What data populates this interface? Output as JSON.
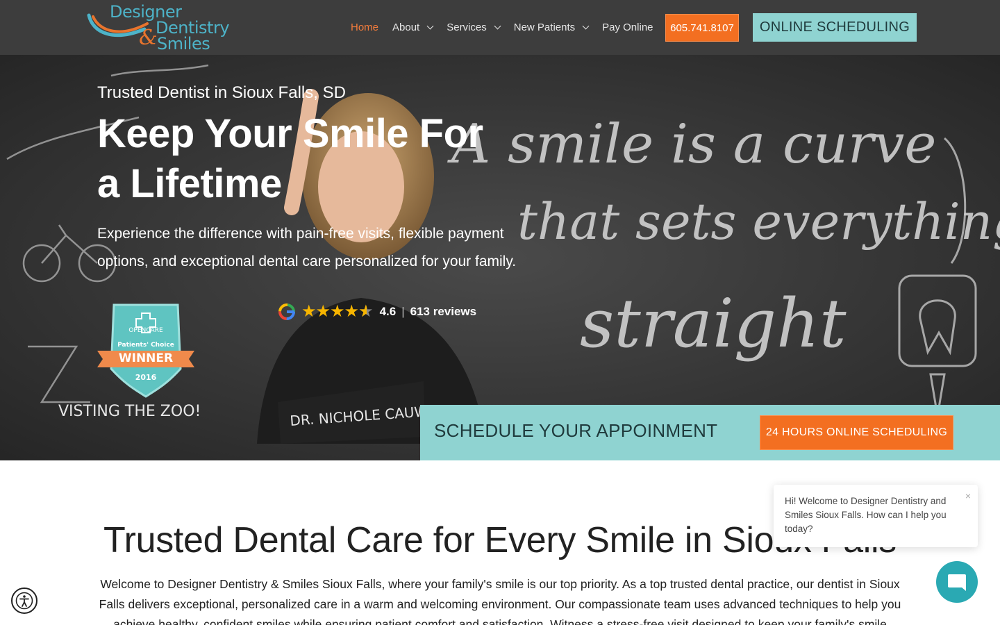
{
  "header": {
    "logo": {
      "line1": "Designer",
      "line2": "Dentistry",
      "amp": "&",
      "line3": "Smiles"
    },
    "nav": [
      {
        "label": "Home",
        "active": true,
        "dropdown": false
      },
      {
        "label": "About",
        "active": false,
        "dropdown": true
      },
      {
        "label": "Services",
        "active": false,
        "dropdown": true
      },
      {
        "label": "New Patients",
        "active": false,
        "dropdown": true
      },
      {
        "label": "Pay Online",
        "active": false,
        "dropdown": false
      }
    ],
    "phone": "605.741.8107",
    "schedule_label": "ONLINE SCHEDULING"
  },
  "hero": {
    "eyebrow": "Trusted Dentist in Sioux Falls, SD",
    "title_line1": "Keep Your Smile For",
    "title_line2": "a Lifetime",
    "subtitle": "Experience the difference with pain-free visits, flexible payment options, and exceptional dental care personalized for your family.",
    "badge": {
      "brand": "OPENCARE",
      "subtitle": "Patients' Choice",
      "title": "WINNER",
      "year": "2016"
    },
    "rating": {
      "score": "4.6",
      "stars": 4.6,
      "reviews": "613 reviews"
    },
    "chalk_words": [
      "A smile is a curve",
      "that sets everything",
      "straight"
    ],
    "nameplate": "DR. NICHOLE CAUW",
    "appointment": {
      "text": "SCHEDULE YOUR APPOINMENT",
      "button": "24 HOURS ONLINE SCHEDULING"
    }
  },
  "content": {
    "title": "Trusted Dental Care for Every Smile in Sioux Falls",
    "body": "Welcome to Designer Dentistry & Smiles Sioux Falls, where your family's smile is our top priority. As a top trusted dental practice, our dentist in Sioux Falls delivers exceptional, personalized care in a warm and welcoming environment. Our compassionate team uses advanced techniques to help you achieve healthy, confident smiles while ensuring patient comfort and satisfaction. Witness a stress-free visit designed to keep your family's smile healthy for years."
  },
  "chat": {
    "message": "Hi! Welcome to Designer Dentistry and Smiles Sioux Falls. How can I help you today?",
    "close": "×"
  },
  "colors": {
    "header_bg": "#3d3d3d",
    "accent_orange": "#f36f21",
    "accent_teal": "#8fd3d1",
    "logo_teal": "#4db3c8",
    "chat_teal": "#2aa9b3"
  },
  "icons": [
    "google-icon",
    "star-icon",
    "chevron-down-icon",
    "chat-icon",
    "accessibility-icon",
    "close-icon"
  ]
}
